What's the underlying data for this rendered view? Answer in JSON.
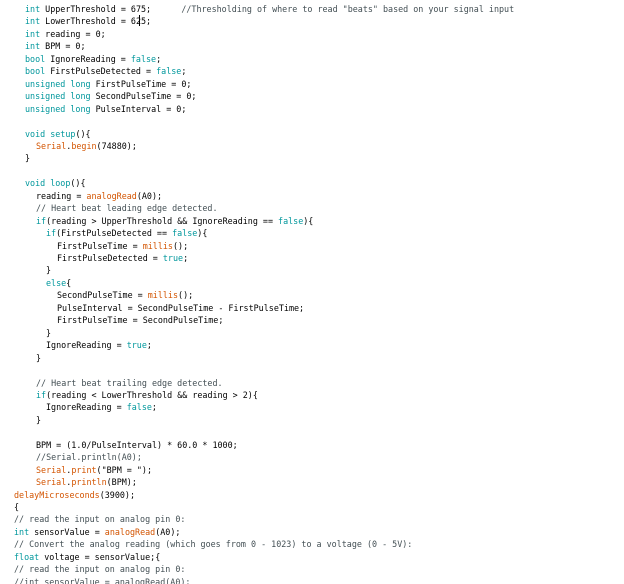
{
  "editor": {
    "colors": {
      "type": "#00979c",
      "function": "#d35400",
      "comment": "#434f54",
      "text": "#000000",
      "background": "#ffffff"
    },
    "lines": [
      {
        "indent": 3,
        "tokens": [
          [
            "type",
            "int"
          ],
          [
            "tx",
            " UpperThreshold = 675;      "
          ],
          [
            "cm",
            "//Thresholding of where to read \"beats\" based on your signal input"
          ]
        ]
      },
      {
        "indent": 3,
        "tokens": [
          [
            "type",
            "int"
          ],
          [
            "tx",
            " LowerThreshold = 625;"
          ]
        ]
      },
      {
        "indent": 3,
        "tokens": [
          [
            "type",
            "int"
          ],
          [
            "tx",
            " reading = 0;"
          ]
        ]
      },
      {
        "indent": 3,
        "tokens": [
          [
            "type",
            "int"
          ],
          [
            "tx",
            " BPM = 0;"
          ]
        ]
      },
      {
        "indent": 3,
        "tokens": [
          [
            "type",
            "bool"
          ],
          [
            "tx",
            " IgnoreReading = "
          ],
          [
            "lit",
            "false"
          ],
          [
            "tx",
            ";"
          ]
        ]
      },
      {
        "indent": 3,
        "tokens": [
          [
            "type",
            "bool"
          ],
          [
            "tx",
            " FirstPulseDetected = "
          ],
          [
            "lit",
            "false"
          ],
          [
            "tx",
            ";"
          ]
        ]
      },
      {
        "indent": 3,
        "tokens": [
          [
            "type",
            "unsigned"
          ],
          [
            "tx",
            " "
          ],
          [
            "type",
            "long"
          ],
          [
            "tx",
            " FirstPulseTime = 0;"
          ]
        ]
      },
      {
        "indent": 3,
        "tokens": [
          [
            "type",
            "unsigned"
          ],
          [
            "tx",
            " "
          ],
          [
            "type",
            "long"
          ],
          [
            "tx",
            " SecondPulseTime = 0;"
          ]
        ]
      },
      {
        "indent": 3,
        "tokens": [
          [
            "type",
            "unsigned"
          ],
          [
            "tx",
            " "
          ],
          [
            "type",
            "long"
          ],
          [
            "tx",
            " PulseInterval = 0;"
          ]
        ]
      },
      {
        "indent": 0,
        "tokens": []
      },
      {
        "indent": 3,
        "tokens": [
          [
            "type",
            "void"
          ],
          [
            "tx",
            " "
          ],
          [
            "kw",
            "setup"
          ],
          [
            "tx",
            "(){"
          ]
        ]
      },
      {
        "indent": 4,
        "tokens": [
          [
            "fn",
            "Serial"
          ],
          [
            "tx",
            "."
          ],
          [
            "fn",
            "begin"
          ],
          [
            "tx",
            "(74880);"
          ]
        ]
      },
      {
        "indent": 3,
        "tokens": [
          [
            "tx",
            "}"
          ]
        ]
      },
      {
        "indent": 0,
        "tokens": []
      },
      {
        "indent": 3,
        "tokens": [
          [
            "type",
            "void"
          ],
          [
            "tx",
            " "
          ],
          [
            "kw",
            "loop"
          ],
          [
            "tx",
            "(){"
          ]
        ]
      },
      {
        "indent": 4,
        "tokens": [
          [
            "tx",
            "reading = "
          ],
          [
            "fn",
            "analogRead"
          ],
          [
            "tx",
            "(A0);"
          ]
        ]
      },
      {
        "indent": 4,
        "tokens": [
          [
            "cm",
            "// Heart beat leading edge detected."
          ]
        ]
      },
      {
        "indent": 4,
        "tokens": [
          [
            "kw",
            "if"
          ],
          [
            "tx",
            "(reading > UpperThreshold && IgnoreReading == "
          ],
          [
            "lit",
            "false"
          ],
          [
            "tx",
            "){"
          ]
        ]
      },
      {
        "indent": 5,
        "tokens": [
          [
            "kw",
            "if"
          ],
          [
            "tx",
            "(FirstPulseDetected == "
          ],
          [
            "lit",
            "false"
          ],
          [
            "tx",
            "){"
          ]
        ]
      },
      {
        "indent": 6,
        "tokens": [
          [
            "tx",
            "FirstPulseTime = "
          ],
          [
            "fn",
            "millis"
          ],
          [
            "tx",
            "();"
          ]
        ]
      },
      {
        "indent": 6,
        "tokens": [
          [
            "tx",
            "FirstPulseDetected = "
          ],
          [
            "lit",
            "true"
          ],
          [
            "tx",
            ";"
          ]
        ]
      },
      {
        "indent": 5,
        "tokens": [
          [
            "tx",
            "}"
          ]
        ]
      },
      {
        "indent": 5,
        "tokens": [
          [
            "kw",
            "else"
          ],
          [
            "tx",
            "{"
          ]
        ]
      },
      {
        "indent": 6,
        "tokens": [
          [
            "tx",
            "SecondPulseTime = "
          ],
          [
            "fn",
            "millis"
          ],
          [
            "tx",
            "();"
          ]
        ]
      },
      {
        "indent": 6,
        "tokens": [
          [
            "tx",
            "PulseInterval = SecondPulseTime - FirstPulseTime;"
          ]
        ]
      },
      {
        "indent": 6,
        "tokens": [
          [
            "tx",
            "FirstPulseTime = SecondPulseTime;"
          ]
        ]
      },
      {
        "indent": 5,
        "tokens": [
          [
            "tx",
            "}"
          ]
        ]
      },
      {
        "indent": 5,
        "tokens": [
          [
            "tx",
            "IgnoreReading = "
          ],
          [
            "lit",
            "true"
          ],
          [
            "tx",
            ";"
          ]
        ]
      },
      {
        "indent": 4,
        "tokens": [
          [
            "tx",
            "}"
          ]
        ]
      },
      {
        "indent": 0,
        "tokens": []
      },
      {
        "indent": 4,
        "tokens": [
          [
            "cm",
            "// Heart beat trailing edge detected."
          ]
        ]
      },
      {
        "indent": 4,
        "tokens": [
          [
            "kw",
            "if"
          ],
          [
            "tx",
            "(reading < LowerThreshold && reading > 2){"
          ]
        ]
      },
      {
        "indent": 5,
        "tokens": [
          [
            "tx",
            "IgnoreReading = "
          ],
          [
            "lit",
            "false"
          ],
          [
            "tx",
            ";"
          ]
        ]
      },
      {
        "indent": 4,
        "tokens": [
          [
            "tx",
            "}"
          ]
        ]
      },
      {
        "indent": 0,
        "tokens": []
      },
      {
        "indent": 4,
        "tokens": [
          [
            "tx",
            "BPM = (1.0/PulseInterval) * 60.0 * 1000;"
          ]
        ]
      },
      {
        "indent": 4,
        "tokens": [
          [
            "cm",
            "//Serial.println(A0);"
          ]
        ]
      },
      {
        "indent": 4,
        "tokens": [
          [
            "fn",
            "Serial"
          ],
          [
            "tx",
            "."
          ],
          [
            "fn",
            "print"
          ],
          [
            "tx",
            "(\"BPM = \");"
          ]
        ]
      },
      {
        "indent": 4,
        "tokens": [
          [
            "fn",
            "Serial"
          ],
          [
            "tx",
            "."
          ],
          [
            "fn",
            "println"
          ],
          [
            "tx",
            "(BPM);"
          ]
        ]
      },
      {
        "indent": 1,
        "tokens": [
          [
            "fn",
            "delayMicroseconds"
          ],
          [
            "tx",
            "(3900);"
          ]
        ]
      },
      {
        "indent": 2,
        "tokens": [
          [
            "tx",
            "{"
          ]
        ]
      },
      {
        "indent": 2,
        "tokens": [
          [
            "cm",
            "// read the input on analog pin 0:"
          ]
        ]
      },
      {
        "indent": 2,
        "tokens": [
          [
            "type",
            "int"
          ],
          [
            "tx",
            " sensorValue = "
          ],
          [
            "fn",
            "analogRead"
          ],
          [
            "tx",
            "(A0);"
          ]
        ]
      },
      {
        "indent": 2,
        "tokens": [
          [
            "cm",
            "// Convert the analog reading (which goes from 0 - 1023) to a voltage (0 - 5V):"
          ]
        ]
      },
      {
        "indent": 2,
        "tokens": [
          [
            "type",
            "float"
          ],
          [
            "tx",
            " voltage = sensorValue;{"
          ]
        ]
      },
      {
        "indent": 2,
        "tokens": [
          [
            "cm",
            "// read the input on analog pin 0:"
          ]
        ]
      },
      {
        "indent": 2,
        "tokens": [
          [
            "cm",
            "//int sensorValue = analogRead(A0);"
          ]
        ]
      }
    ]
  }
}
